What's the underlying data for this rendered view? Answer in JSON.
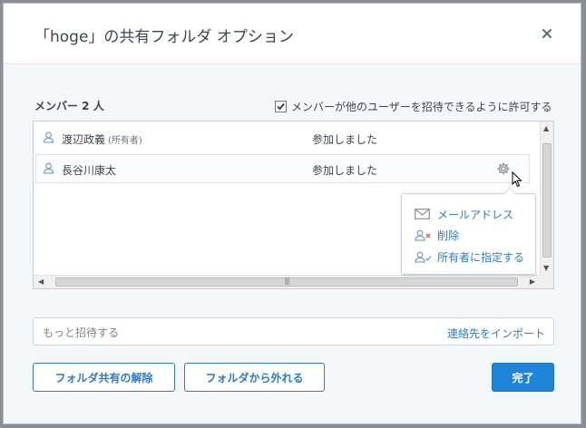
{
  "dialog": {
    "title": "「hoge」の共有フォルダ オプション",
    "close_symbol": "×"
  },
  "members": {
    "label": "メンバー 2 人",
    "allow_invite_label": "メンバーが他のユーザーを招待できるように許可する",
    "allow_invite_checked": true,
    "rows": [
      {
        "name": "渡辺政義",
        "role": "(所有者)",
        "status": "参加しました",
        "icon": "user-icon"
      },
      {
        "name": "長谷川康太",
        "role": "",
        "status": "参加しました",
        "icon": "user-icon"
      }
    ]
  },
  "menu": {
    "items": [
      {
        "label": "メールアドレス",
        "icon": "envelope-icon"
      },
      {
        "label": "削除",
        "icon": "remove-user-icon"
      },
      {
        "label": "所有者に指定する",
        "icon": "make-owner-icon"
      }
    ]
  },
  "invite": {
    "placeholder": "もっと招待する",
    "import_label": "連絡先をインポート"
  },
  "buttons": {
    "unshare": "フォルダ共有の解除",
    "leave": "フォルダから外れる",
    "done": "完了"
  },
  "colors": {
    "accent": "#2b7bd0",
    "primary_button": "#1f85d8",
    "text": "#3d464d"
  }
}
